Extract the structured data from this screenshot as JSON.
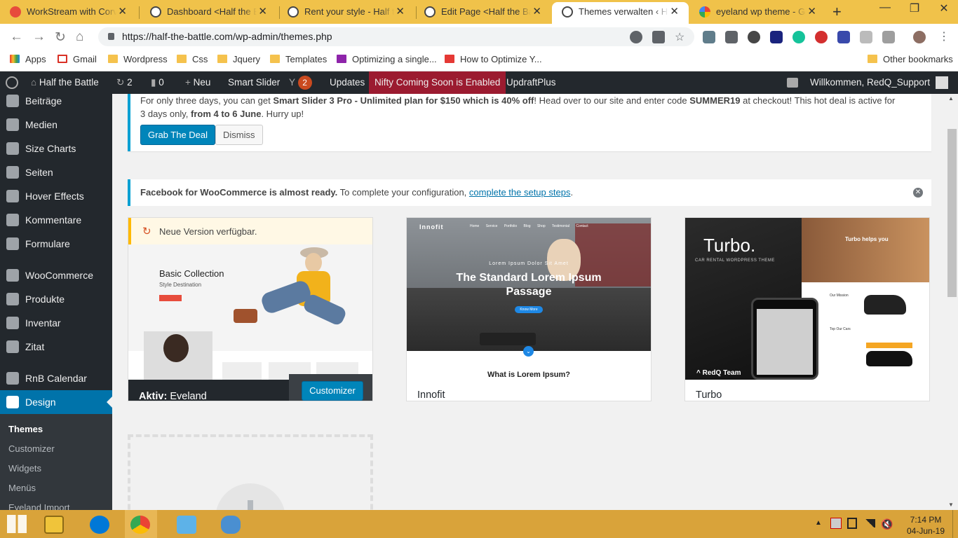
{
  "browser": {
    "tabs": [
      {
        "title": "WorkStream with Corvin",
        "icon": "workstream-icon"
      },
      {
        "title": "Dashboard <Half the Bat",
        "icon": "wordpress-icon"
      },
      {
        "title": "Rent your style - Half the",
        "icon": "wordpress-icon"
      },
      {
        "title": "Edit Page <Half the Batt",
        "icon": "wordpress-icon"
      },
      {
        "title": "Themes verwalten ‹ Half",
        "icon": "wordpress-icon"
      },
      {
        "title": "eyeland wp theme - Goo",
        "icon": "google-icon"
      }
    ],
    "new_tab": "+",
    "url": "https://half-the-battle.com/wp-admin/themes.php",
    "bookmarks": [
      "Apps",
      "Gmail",
      "Wordpress",
      "Css",
      "Jquery",
      "Templates",
      "Optimizing a single...",
      "How to Optimize Y...",
      "Other bookmarks"
    ]
  },
  "adminbar": {
    "site": "Half the Battle",
    "updates_count": "2",
    "comments_count": "0",
    "new_label": "Neu",
    "smart_slider": "Smart Slider",
    "yoast_count": "2",
    "updates_label": "Updates",
    "nifty": "Nifty Coming Soon is Enabled",
    "updraft": "UpdraftPlus",
    "welcome": "Willkommen, RedQ_Support"
  },
  "sidebar": {
    "items": [
      "Beiträge",
      "Medien",
      "Size Charts",
      "Seiten",
      "Hover Effects",
      "Kommentare",
      "Formulare",
      "WooCommerce",
      "Produkte",
      "Inventar",
      "Zitat",
      "RnB Calendar",
      "Design"
    ],
    "submenu": [
      "Themes",
      "Customizer",
      "Widgets",
      "Menüs",
      "Eyeland Import"
    ]
  },
  "notice1": {
    "pre": "For only three days, you can get ",
    "bold1": "Smart Slider 3 Pro - Unlimited plan for $150 which is 40% off",
    "mid": "! Head over to our site and enter code ",
    "bold2": "SUMMER19",
    "mid2": " at checkout! This hot deal is active for 3 days only, ",
    "bold3": "from 4 to 6 June",
    "post": ". Hurry up!",
    "grab": "Grab The Deal",
    "dismiss": "Dismiss"
  },
  "notice2": {
    "bold": "Facebook for WooCommerce is almost ready.",
    "text": " To complete your configuration, ",
    "link": "complete the setup steps",
    "end": "."
  },
  "themes": {
    "active": {
      "update": "Neue Version verfügbar.",
      "label": "Aktiv:",
      "name": "Eveland",
      "button": "Customizer",
      "preview_title": "Basic Collection",
      "preview_sub": "Style Destination"
    },
    "innofit": {
      "name": "Innofit",
      "logo": "Innofit",
      "nav": [
        "Home",
        "Service",
        "Portfolio",
        "Blog",
        "Shop",
        "Testimonial",
        "Contact"
      ],
      "kicker": "Lorem Ipsum Dolor Sit Amet",
      "headline": "The Standard Lorem Ipsum Passage",
      "cta": "Know More",
      "footer": "What is Lorem Ipsum?"
    },
    "turbo": {
      "name": "Turbo",
      "logo": "Turbo.",
      "tagline": "CAR RENTAL WORDPRESS THEME",
      "helps": "Turbo helps you",
      "team": "RedQ Team",
      "mission": "Our Mission",
      "cars": "Top Our Cars"
    }
  },
  "taskbar": {
    "time": "7:14 PM",
    "date": "04-Jun-19"
  }
}
